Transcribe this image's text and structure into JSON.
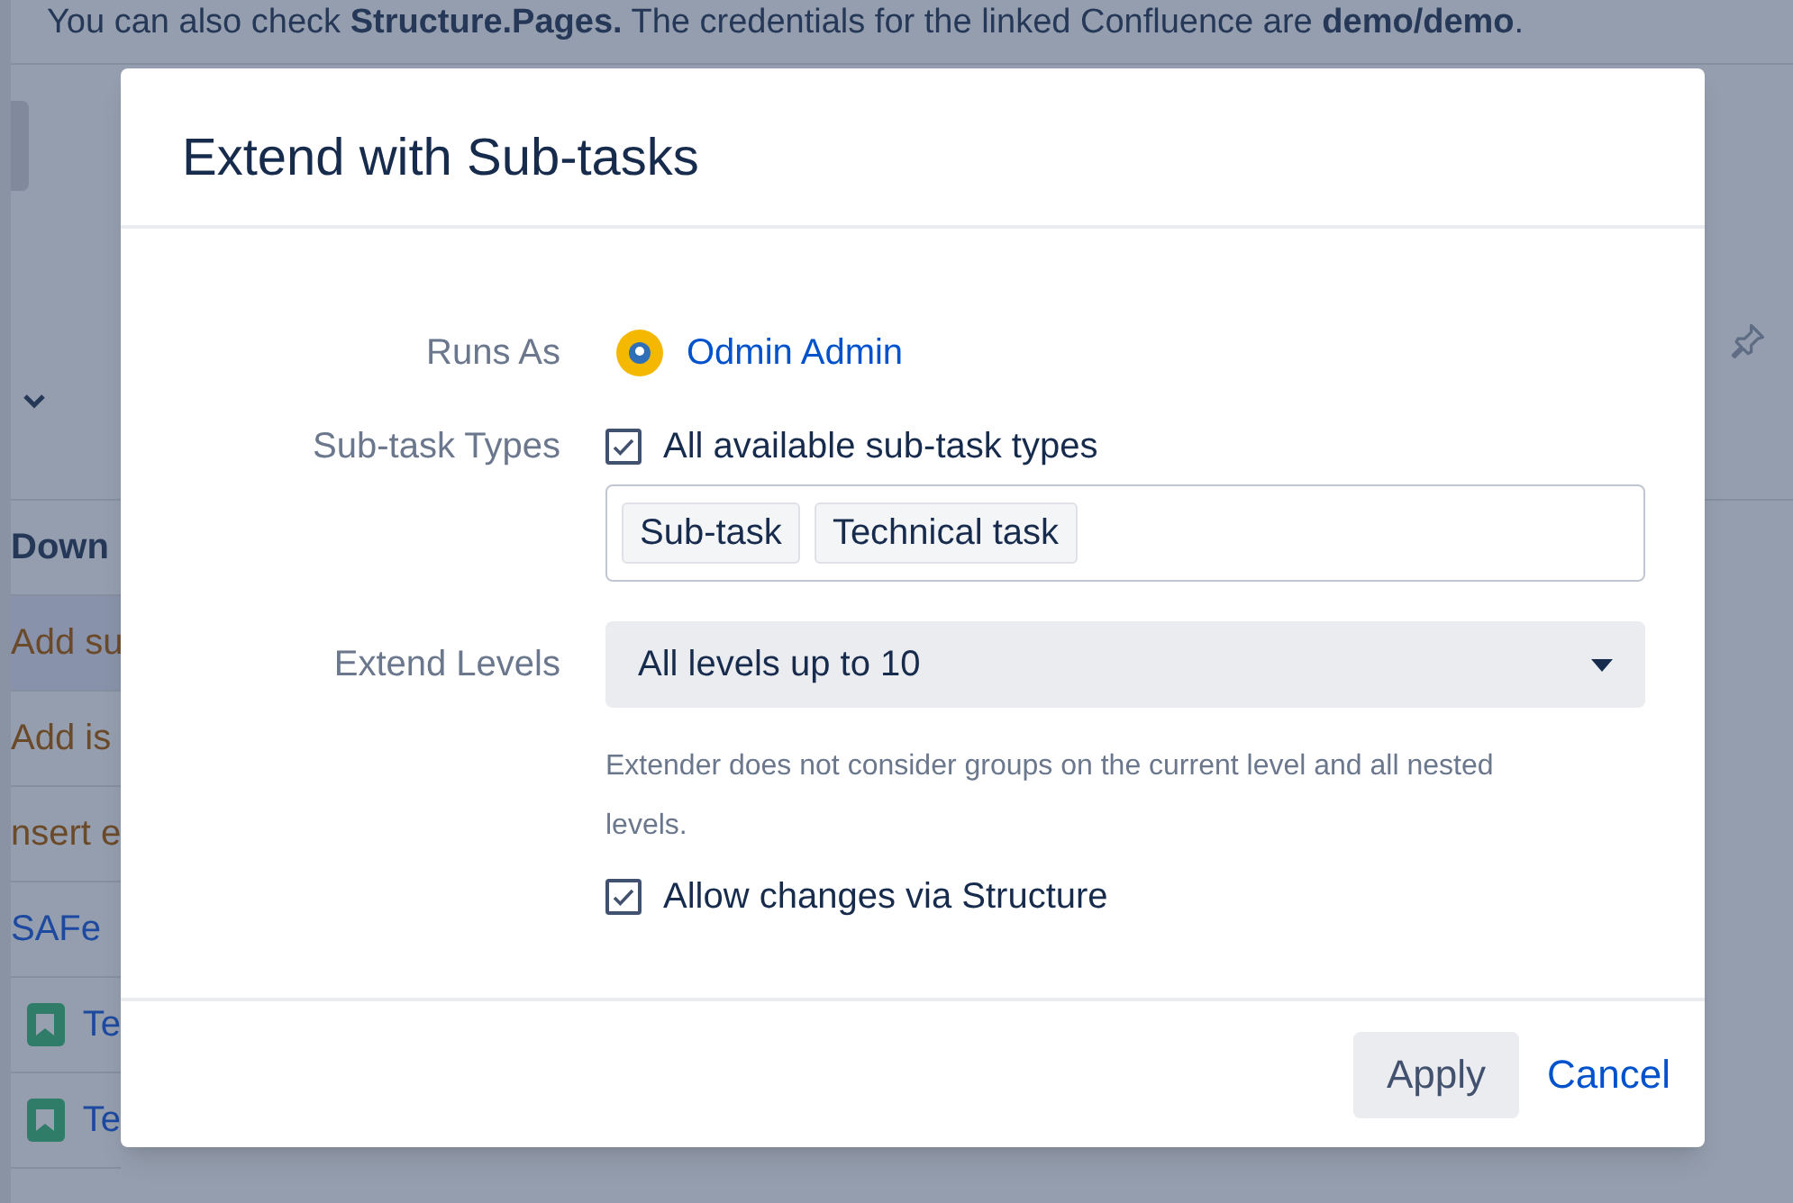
{
  "background": {
    "banner": "You can also check **Structure.Pages.** The credentials for the linked Confluence are **demo/demo**.",
    "rows": [
      {
        "kind": "header",
        "text": "Down",
        "selected": false
      },
      {
        "kind": "action",
        "text": "Add su",
        "selected": true
      },
      {
        "kind": "action",
        "text": "Add is",
        "selected": false
      },
      {
        "kind": "action",
        "text": "nsert e",
        "selected": false
      },
      {
        "kind": "link",
        "text": "SAFe",
        "selected": false
      },
      {
        "kind": "issue",
        "text": "Te",
        "selected": false
      },
      {
        "kind": "issue",
        "text": "Te",
        "selected": false
      }
    ]
  },
  "dialog": {
    "title": "Extend with Sub-tasks",
    "runs_as": {
      "label": "Runs As",
      "user": "Odmin Admin"
    },
    "subtask_types": {
      "label": "Sub-task Types",
      "all": {
        "label": "All available sub-task types",
        "checked": true
      },
      "tags": [
        "Sub-task",
        "Technical task"
      ]
    },
    "extend_levels": {
      "label": "Extend Levels",
      "value": "All levels up to 10",
      "help": "Extender does not consider groups on the current level and all nested levels."
    },
    "allow_changes": {
      "label": "Allow changes via Structure",
      "checked": true
    },
    "buttons": {
      "apply": "Apply",
      "cancel": "Cancel"
    }
  }
}
